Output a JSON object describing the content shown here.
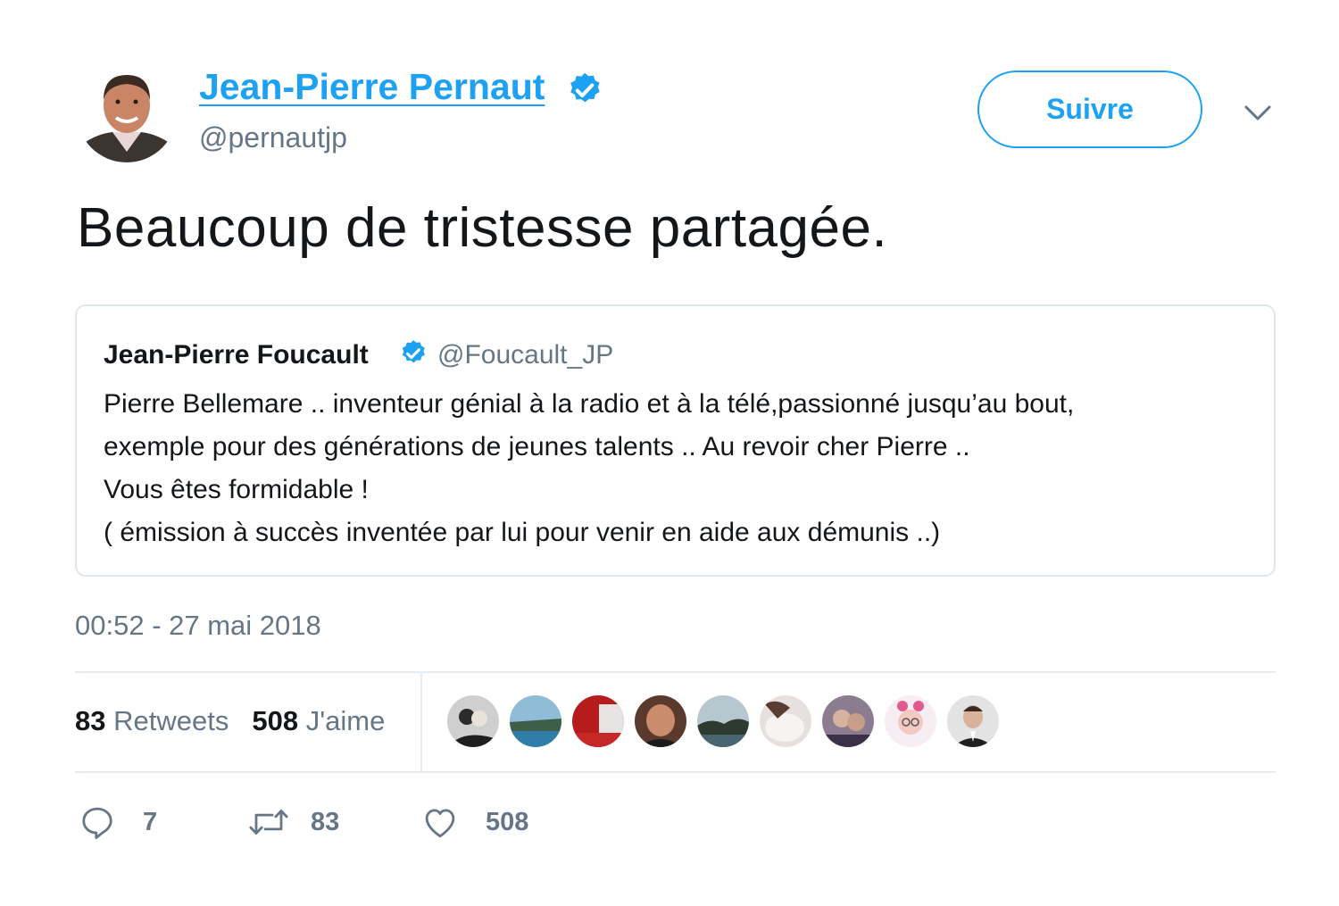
{
  "author": {
    "display_name": "Jean-Pierre Pernaut",
    "handle": "@pernautjp",
    "verified_icon": "verified-badge-icon",
    "follow_label": "Suivre",
    "menu_icon": "chevron-down-icon"
  },
  "tweet": {
    "text": "Beaucoup de tristesse partagée.",
    "timestamp": "00:52 - 27 mai 2018"
  },
  "quoted_tweet": {
    "display_name": "Jean-Pierre Foucault",
    "handle": "@Foucault_JP",
    "lines": [
      "Pierre Bellemare .. inventeur génial à la radio et à la télé,passionné jusqu’au bout,",
      "exemple pour des générations de jeunes talents .. Au revoir cher Pierre ..",
      "Vous êtes formidable !",
      "( émission à succès inventée par lui pour venir en aide aux démunis ..)"
    ]
  },
  "stats": {
    "retweets_count": "83",
    "retweets_label": "Retweets",
    "likes_count": "508",
    "likes_label": "J'aime"
  },
  "likers_count_shown": 9,
  "actions": {
    "reply": {
      "icon": "reply-icon",
      "count": "7"
    },
    "retweet": {
      "icon": "retweet-icon",
      "count": "83"
    },
    "like": {
      "icon": "heart-icon",
      "count": "508"
    }
  },
  "colors": {
    "accent": "#1da1f2",
    "secondary_text": "#657786",
    "primary_text": "#14171a",
    "border": "#e1e8ed"
  }
}
